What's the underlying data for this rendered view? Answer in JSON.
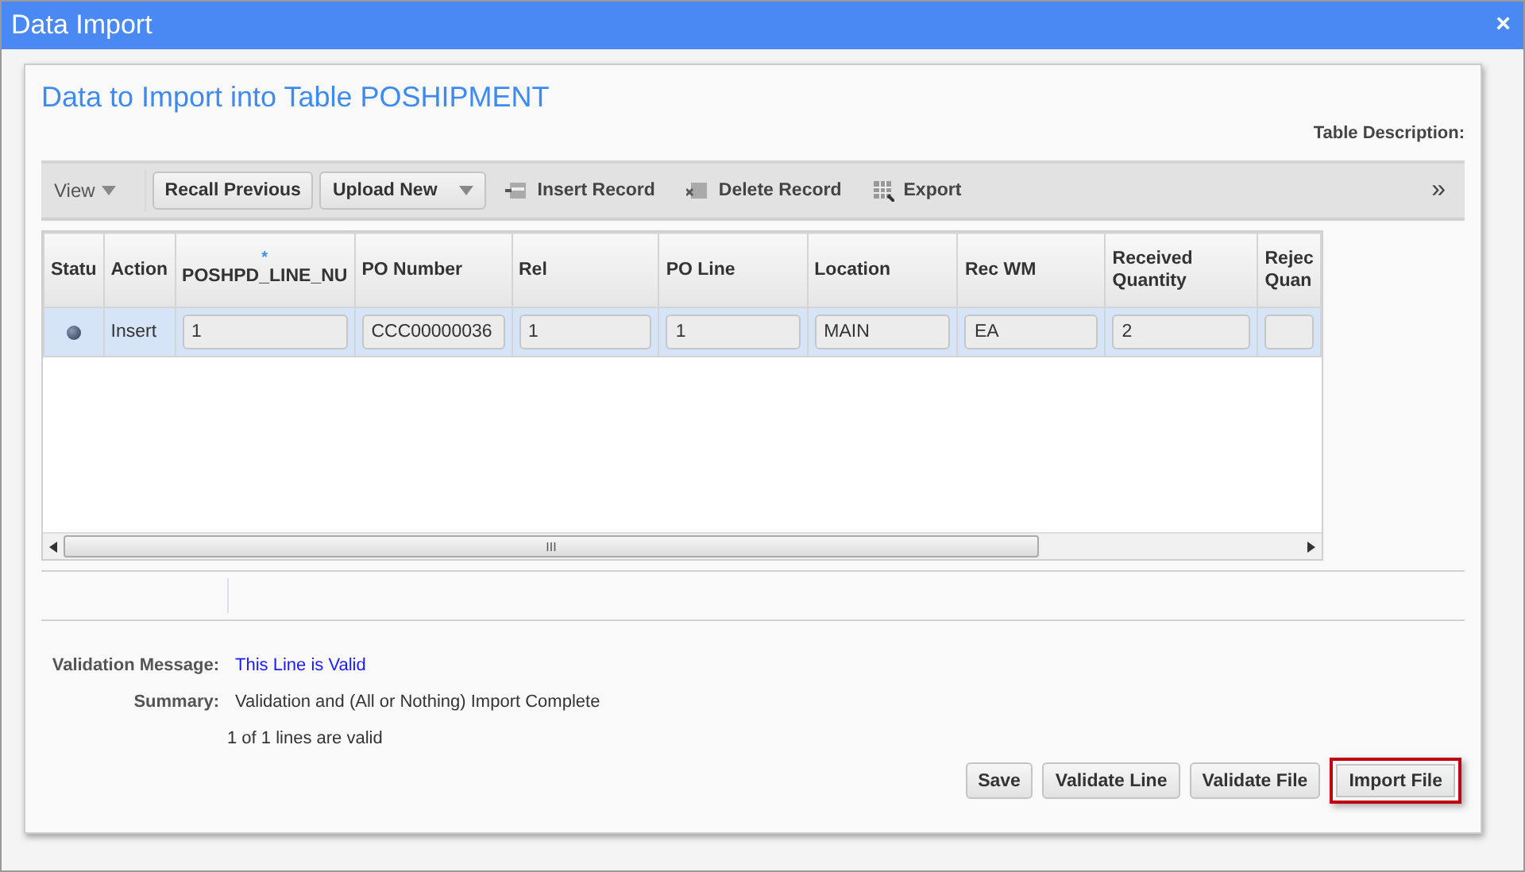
{
  "window": {
    "title": "Data Import",
    "close": "×"
  },
  "heading": "Data to Import into Table POSHIPMENT",
  "table_description_label": "Table Description:",
  "toolbar": {
    "items": [
      {
        "kind": "menu",
        "label": "View"
      },
      {
        "kind": "button",
        "label": "Recall Previous"
      },
      {
        "kind": "dropdown",
        "label": "Upload New"
      },
      {
        "kind": "insert",
        "label": "Insert Record"
      },
      {
        "kind": "delete",
        "label": "Delete Record"
      },
      {
        "kind": "export",
        "label": "Export"
      }
    ],
    "overflow": "»"
  },
  "table": {
    "columns": [
      {
        "label": "Statu"
      },
      {
        "label": "Action"
      },
      {
        "label": "POSHPD_LINE_NU",
        "required_mark": "*"
      },
      {
        "label": "PO Number"
      },
      {
        "label": "Rel"
      },
      {
        "label": "PO Line"
      },
      {
        "label": "Location"
      },
      {
        "label": "Rec WM"
      },
      {
        "label": "Received Quantity"
      },
      {
        "label": "Rejec Quan"
      }
    ],
    "rows": [
      {
        "selected": true,
        "action": "Insert",
        "values": [
          "1",
          "CCC00000036",
          "1",
          "1",
          "MAIN",
          "EA",
          "2"
        ]
      }
    ],
    "scroll_mark": "III"
  },
  "validation": {
    "label": "Validation Message:",
    "value": "This Line is Valid"
  },
  "summary": {
    "label": "Summary:",
    "value": "Validation and (All or Nothing) Import Complete",
    "count": "1 of 1 lines are valid"
  },
  "buttons": [
    {
      "label": "Save",
      "highlighted": false
    },
    {
      "label": "Validate Line",
      "highlighted": false
    },
    {
      "label": "Validate File",
      "highlighted": false
    },
    {
      "label": "Import File",
      "highlighted": true
    }
  ]
}
